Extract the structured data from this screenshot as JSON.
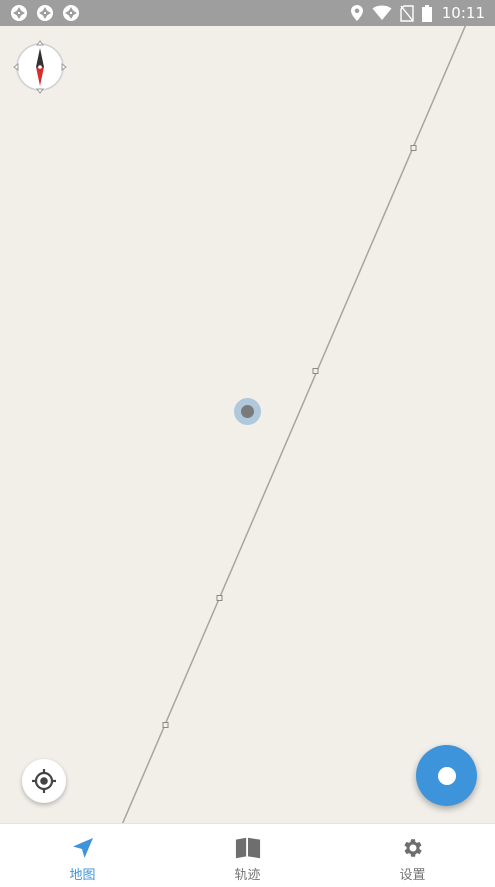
{
  "status_bar": {
    "time": "10:11",
    "left_icons": [
      "notification-aperture-icon",
      "notification-aperture-icon",
      "notification-aperture-icon"
    ],
    "right_icons": [
      "location-pin-icon",
      "wifi-icon",
      "no-sim-icon",
      "battery-icon"
    ]
  },
  "map": {
    "compass_icon": "compass-icon",
    "current_location": "current-location-dot",
    "locate_icon": "crosshair-icon",
    "record_button_icon": "record-dot-icon"
  },
  "bottom_nav": {
    "active_tab": "map",
    "tabs": [
      {
        "id": "map",
        "label": "地图",
        "icon": "navigation-arrow-icon"
      },
      {
        "id": "tracks",
        "label": "轨迹",
        "icon": "book-map-icon"
      },
      {
        "id": "settings",
        "label": "设置",
        "icon": "gear-icon"
      }
    ]
  },
  "colors": {
    "accent": "#3d94db",
    "map_background": "#f2efe9",
    "status_bar": "#9e9e9e",
    "inactive": "#757575",
    "route_line": "#a9a59d"
  }
}
